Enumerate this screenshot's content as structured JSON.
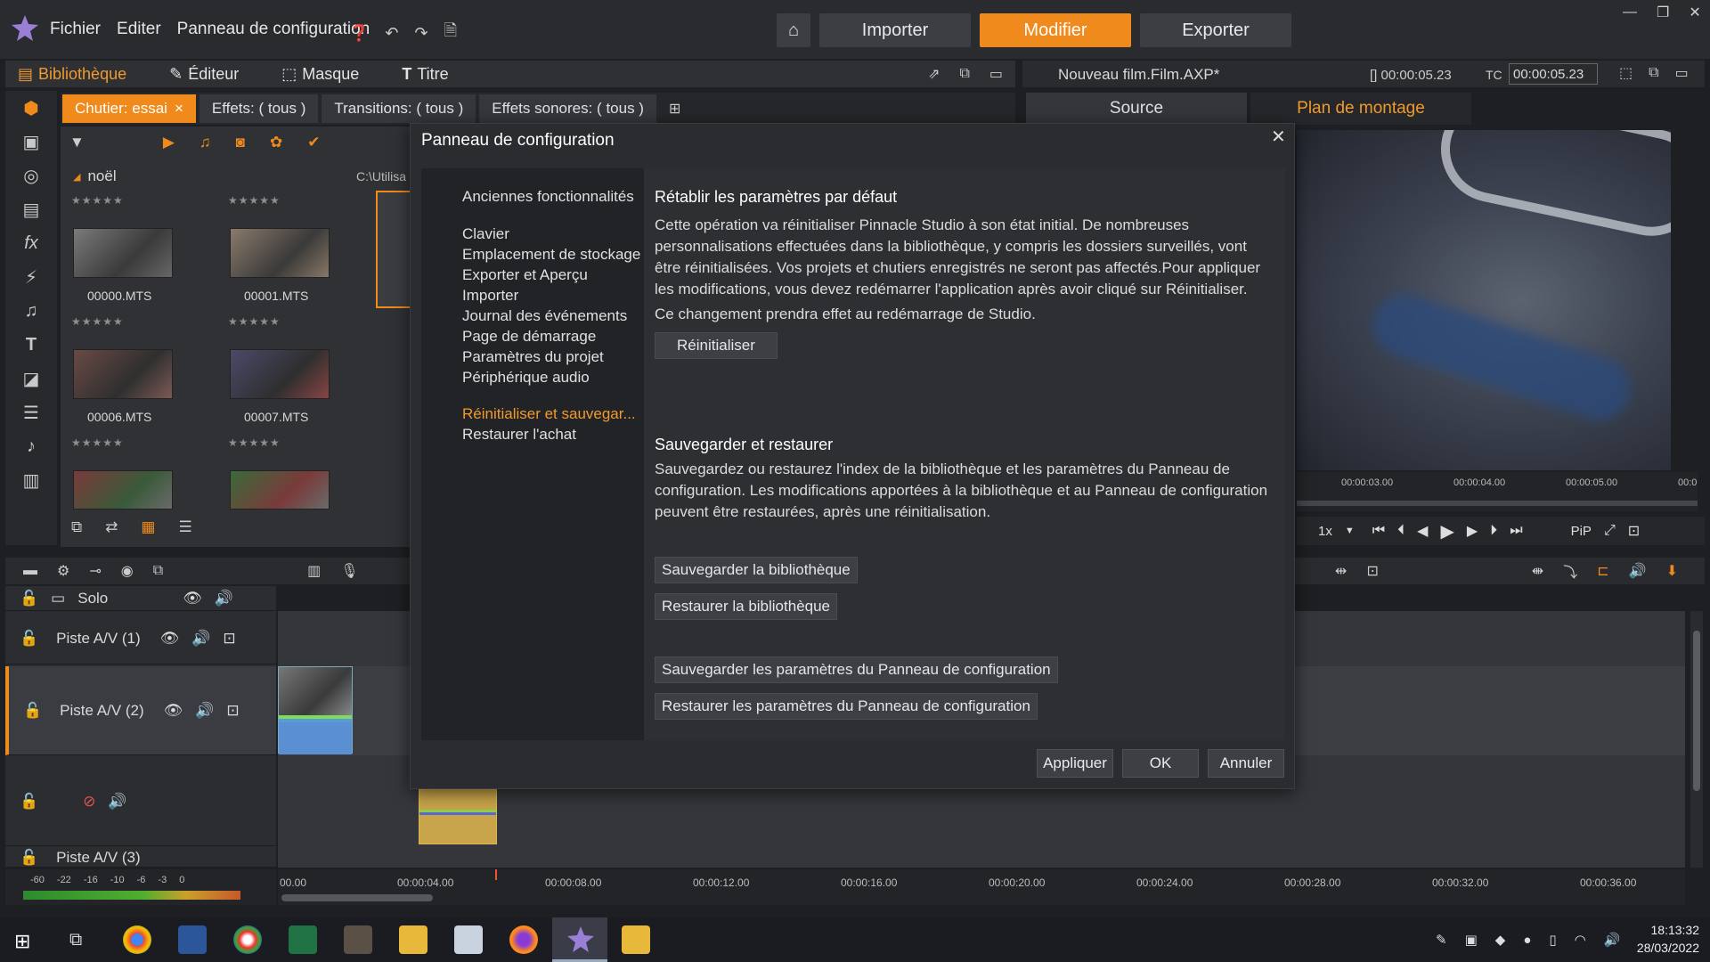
{
  "titlebar": {
    "menu": [
      "Fichier",
      "Editer",
      "Panneau de configuration"
    ],
    "modes": [
      "Importer",
      "Modifier",
      "Exporter"
    ],
    "active_mode": "Modifier"
  },
  "library_bar": {
    "tabs": [
      "Bibliothèque",
      "Éditeur",
      "Masque",
      "Titre"
    ]
  },
  "bin_tabs": [
    "Chutier: essai",
    "Effets: ( tous )",
    "Transitions: ( tous )",
    "Effets sonores: ( tous )"
  ],
  "library": {
    "folder": "noël",
    "path": "C:\\Utilisa",
    "stars": "★★★★★",
    "clips": [
      "00000.MTS",
      "00001.MTS",
      "00006.MTS",
      "00007.MTS"
    ]
  },
  "preview": {
    "project_name": "Nouveau film.Film.AXP*",
    "duration": "[] 00:00:05.23",
    "tc_label": "TC",
    "timecode": "00:00:05.23",
    "tabs": [
      "Source",
      "Plan de montage"
    ],
    "ruler_ticks": [
      "00:00:03.00",
      "00:00:04.00",
      "00:00:05.00",
      "00:0"
    ],
    "speed": "1x",
    "pip": "PiP"
  },
  "timeline": {
    "solo_label": "Solo",
    "tracks": [
      "Piste A/V (1)",
      "Piste A/V (2)",
      "",
      "Piste A/V (3)"
    ],
    "ruler_ticks": [
      "00.00",
      "00:00:04.00",
      "00:00:08.00",
      "00:00:12.00",
      "00:00:16.00",
      "00:00:20.00",
      "00:00:24.00",
      "00:00:28.00",
      "00:00:32.00",
      "00:00:36.00"
    ],
    "meter_ticks": [
      "-60",
      "-22",
      "-16",
      "-10",
      "-6",
      "-3",
      "0"
    ]
  },
  "dialog": {
    "title": "Panneau de configuration",
    "nav": [
      "Anciennes fonctionnalités",
      "Clavier",
      "Emplacement de stockage",
      "Exporter et Aperçu",
      "Importer",
      "Journal des événements",
      "Page de démarrage",
      "Paramètres du projet",
      "Périphérique audio",
      "Réinitialiser et sauvegar...",
      "Restaurer l'achat"
    ],
    "active_nav": "Réinitialiser et sauvegar...",
    "reset_title": "Rétablir les paramètres par défaut",
    "reset_text": "Cette opération va réinitialiser Pinnacle Studio à son état initial. De nombreuses personnalisations effectuées dans la bibliothèque, y compris les dossiers surveillés, vont être réinitialisées. Vos projets et chutiers enregistrés ne seront pas affectés.Pour appliquer les modifications, vous devez redémarrer l'application après avoir cliqué sur Réinitialiser.",
    "reset_note": "Ce changement prendra effet au redémarrage de Studio.",
    "reset_button": "Réinitialiser",
    "backup_title": "Sauvegarder et restaurer",
    "backup_text": "Sauvegardez ou restaurez l'index de la bibliothèque et les paramètres du Panneau de configuration. Les modifications apportées à la bibliothèque et au Panneau de configuration peuvent être restaurées, après une réinitialisation.",
    "save_library": "Sauvegarder la bibliothèque",
    "restore_library": "Restaurer la bibliothèque",
    "save_settings": "Sauvegarder les paramètres du Panneau de configuration",
    "restore_settings": "Restaurer les paramètres du Panneau de configuration",
    "apply": "Appliquer",
    "ok": "OK",
    "cancel": "Annuler"
  },
  "taskbar": {
    "time": "18:13:32",
    "date": "28/03/2022"
  },
  "colors": {
    "accent": "#f08a1c",
    "accent_text": "#f09a2e",
    "dialog_bg": "#2b2c30"
  }
}
